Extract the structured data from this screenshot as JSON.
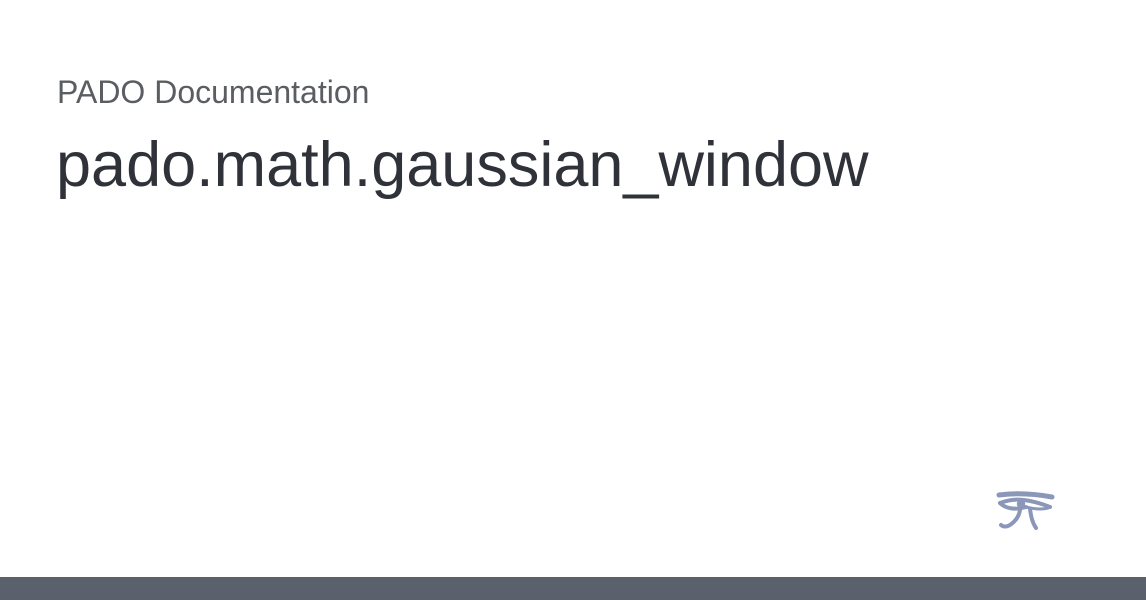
{
  "header": {
    "site_name": "PADO Documentation",
    "page_title": "pado.math.gaussian_window"
  },
  "logo": {
    "icon": "eye-of-horus-icon",
    "color": "#8a97b8"
  },
  "colors": {
    "background": "#ffffff",
    "site_name_text": "#5a5d62",
    "title_text": "#2f3339",
    "bottom_bar": "#5b616c"
  }
}
